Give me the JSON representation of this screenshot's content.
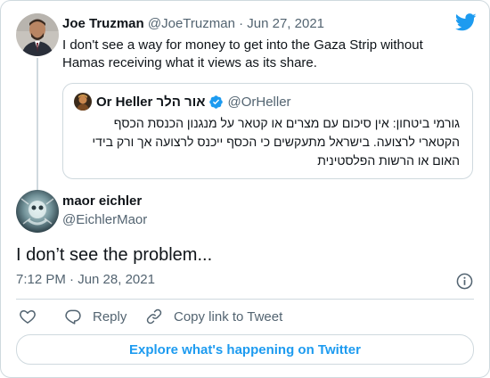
{
  "parent": {
    "name": "Joe Truzman",
    "handle": "@JoeTruzman",
    "separator": "·",
    "date": "Jun 27, 2021",
    "text": "I don't see a way for money to get into the Gaza Strip without Hamas receiving what it views as its share."
  },
  "quoted": {
    "name": "Or Heller אור הלר",
    "handle": "@OrHeller",
    "text": "גורמי ביטחון: אין סיכום עם מצרים או קטאר על מנגנון הכנסת הכסף הקטארי לרצועה. בישראל מתעקשים כי הכסף ייכנס לרצועה אך ורק בידי האום או הרשות הפלסטינית"
  },
  "reply": {
    "name": "maor eichler",
    "handle": "@EichlerMaor",
    "text": "I don’t see the problem...",
    "timestamp": "7:12 PM · Jun 28, 2021"
  },
  "actions": {
    "reply_label": "Reply",
    "copy_link_label": "Copy link to Tweet"
  },
  "explore_label": "Explore what's happening on Twitter",
  "colors": {
    "accent": "#1d9bf0",
    "muted": "#536471",
    "border": "#cfd9de",
    "text": "#0f1419"
  },
  "icons": [
    "twitter-bird-icon",
    "verified-badge-icon",
    "info-icon",
    "heart-icon",
    "reply-icon",
    "link-icon"
  ]
}
